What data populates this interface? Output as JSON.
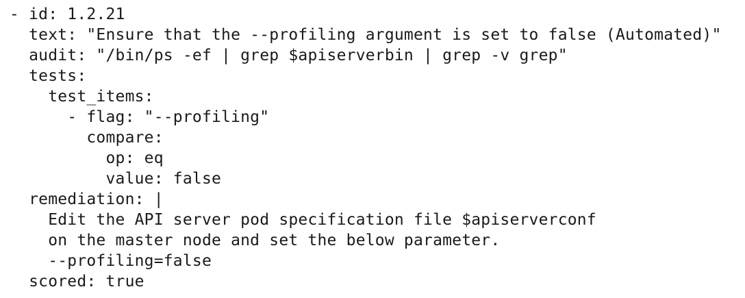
{
  "code": {
    "lines": [
      "- id: 1.2.21",
      "  text: \"Ensure that the --profiling argument is set to false (Automated)\"",
      "  audit: \"/bin/ps -ef | grep $apiserverbin | grep -v grep\"",
      "  tests:",
      "    test_items:",
      "      - flag: \"--profiling\"",
      "        compare:",
      "          op: eq",
      "          value: false",
      "  remediation: |",
      "    Edit the API server pod specification file $apiserverconf",
      "    on the master node and set the below parameter.",
      "    --profiling=false",
      "  scored: true"
    ]
  }
}
